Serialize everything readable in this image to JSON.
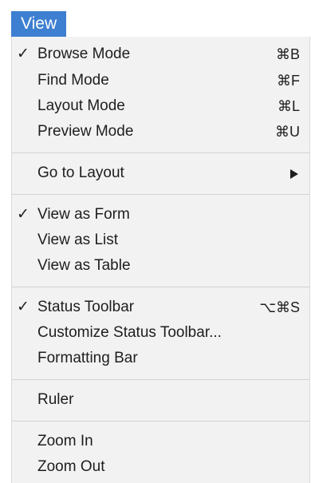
{
  "menubar": {
    "title": "View"
  },
  "menu": {
    "browse_mode": {
      "label": "Browse Mode",
      "shortcut": "⌘B",
      "checked": true
    },
    "find_mode": {
      "label": "Find Mode",
      "shortcut": "⌘F"
    },
    "layout_mode": {
      "label": "Layout Mode",
      "shortcut": "⌘L"
    },
    "preview_mode": {
      "label": "Preview Mode",
      "shortcut": "⌘U"
    },
    "go_to_layout": {
      "label": "Go to Layout"
    },
    "view_as_form": {
      "label": "View as Form",
      "checked": true
    },
    "view_as_list": {
      "label": "View as List"
    },
    "view_as_table": {
      "label": "View as Table"
    },
    "status_toolbar": {
      "label": "Status Toolbar",
      "shortcut": "⌥⌘S",
      "checked": true
    },
    "customize_status_toolbar": {
      "label": "Customize Status Toolbar..."
    },
    "formatting_bar": {
      "label": "Formatting Bar"
    },
    "ruler": {
      "label": "Ruler"
    },
    "zoom_in": {
      "label": "Zoom In"
    },
    "zoom_out": {
      "label": "Zoom Out"
    },
    "check_glyph": "✓"
  },
  "colors": {
    "menu_title_bg": "#3d7fd0",
    "menu_bg": "#f2f2f2",
    "separator": "#d3d3d3"
  }
}
